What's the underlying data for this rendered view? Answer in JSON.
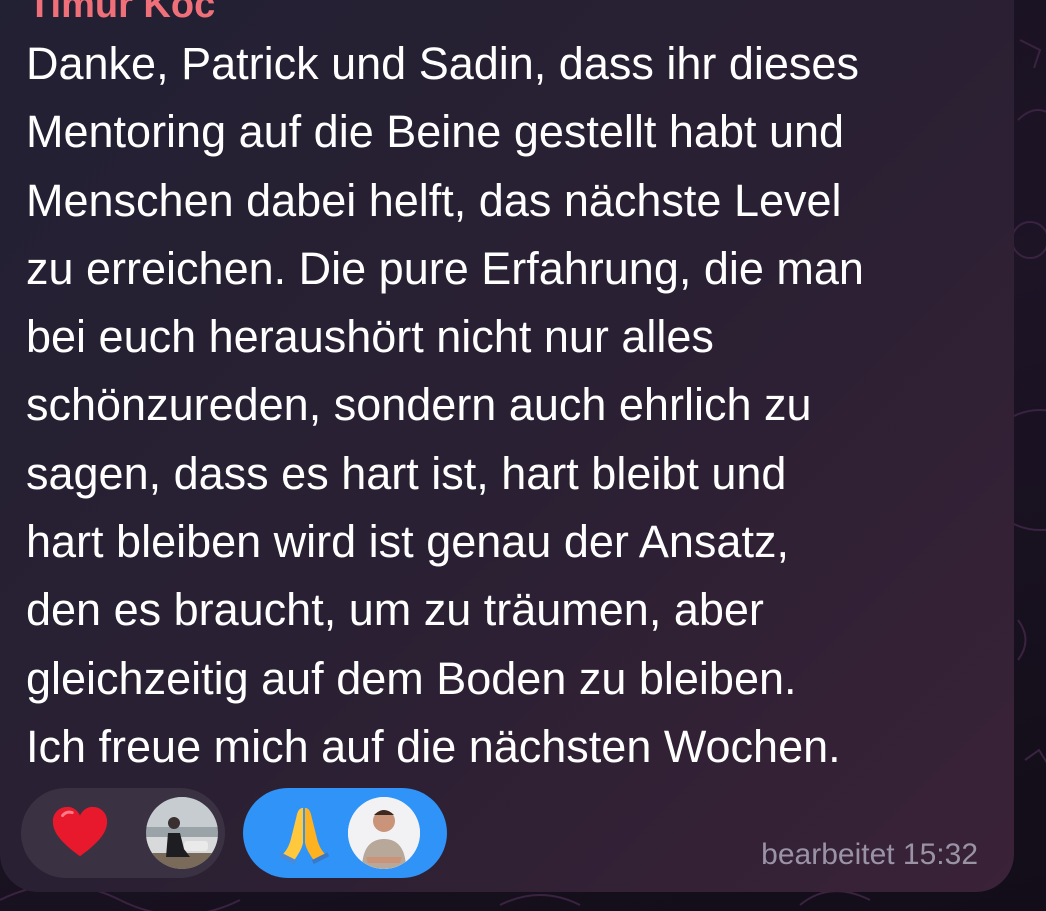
{
  "message": {
    "sender": "Timur Koc",
    "lines": [
      "Danke, Patrick und Sadin, dass ihr dieses",
      "Mentoring auf die Beine gestellt habt und",
      "Menschen dabei helft, das nächste Level",
      "zu erreichen. Die pure Erfahrung, die man",
      "bei euch heraushört nicht nur alles",
      "schönzureden, sondern auch ehrlich zu",
      "sagen, dass es hart ist, hart bleibt und",
      "hart bleiben wird ist genau der Ansatz,",
      "den es braucht, um zu träumen, aber",
      "gleichzeitig auf dem Boden zu bleiben.",
      "Ich freue mich auf die nächsten Wochen."
    ],
    "status": "bearbeitet 15:32"
  },
  "reactions": [
    {
      "emoji": "heart-emoji",
      "selected": false,
      "color": "#3a3242"
    },
    {
      "emoji": "folded-hands-emoji",
      "selected": true,
      "color": "#2f93f7"
    }
  ],
  "colors": {
    "sender_name": "#f0707a",
    "text": "#ffffff",
    "meta": "#9a93a6"
  }
}
